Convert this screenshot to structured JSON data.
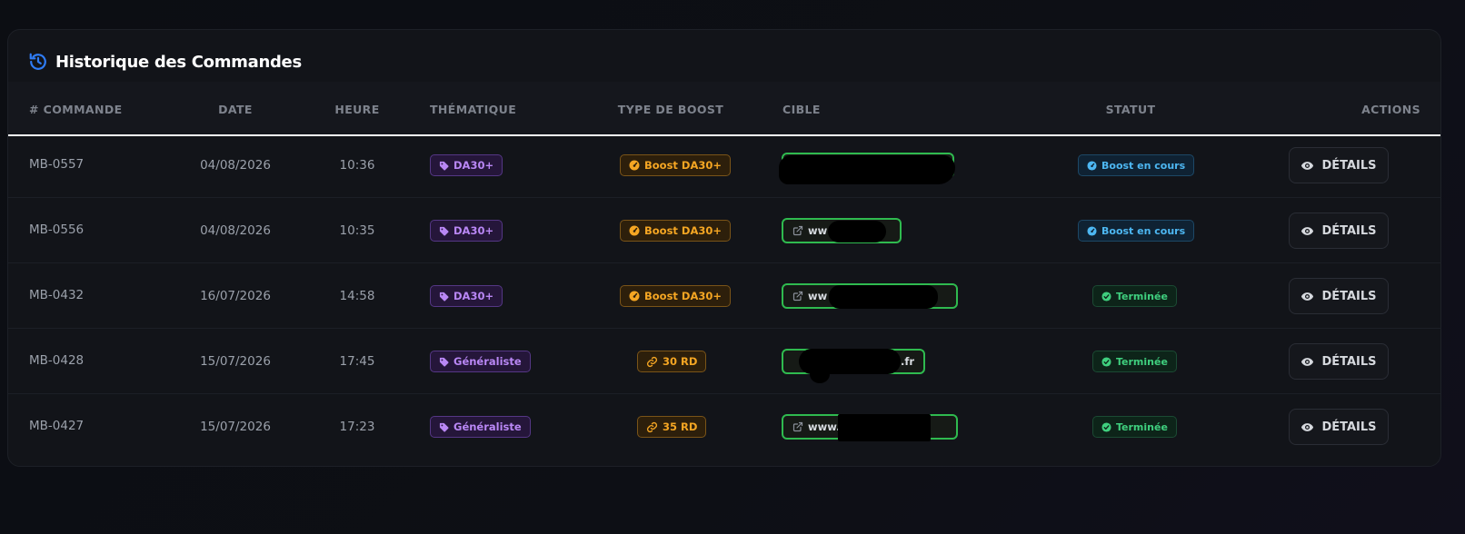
{
  "header": {
    "title": "Historique des Commandes",
    "icon": "history-icon"
  },
  "columns": {
    "commande": "# COMMANDE",
    "date": "DATE",
    "heure": "HEURE",
    "thematique": "THÉMATIQUE",
    "type_boost": "TYPE DE BOOST",
    "cible": "CIBLE",
    "statut": "STATUT",
    "actions": "ACTIONS"
  },
  "rows": [
    {
      "id": "MB-0557",
      "date": "04/08/2026",
      "time": "10:36",
      "theme": "DA30+",
      "boost": "Boost DA30+",
      "boost_icon": "gauge-icon",
      "target": "",
      "status": "Boost en cours",
      "action": "DÉTAILS"
    },
    {
      "id": "MB-0556",
      "date": "04/08/2026",
      "time": "10:35",
      "theme": "DA30+",
      "boost": "Boost DA30+",
      "boost_icon": "gauge-icon",
      "target": "ww          .fr",
      "status": "Boost en cours",
      "action": "DÉTAILS"
    },
    {
      "id": "MB-0432",
      "date": "16/07/2026",
      "time": "14:58",
      "theme": "DA30+",
      "boost": "Boost DA30+",
      "boost_icon": "gauge-icon",
      "target": "ww                    .fr",
      "status": "Terminée",
      "action": "DÉTAILS"
    },
    {
      "id": "MB-0428",
      "date": "15/07/2026",
      "time": "17:45",
      "theme": "Généraliste",
      "boost": "30 RD",
      "boost_icon": "link-icon",
      "target": ".fr",
      "status": "Terminée",
      "action": "DÉTAILS"
    },
    {
      "id": "MB-0427",
      "date": "15/07/2026",
      "time": "17:23",
      "theme": "Généraliste",
      "boost": "35 RD",
      "boost_icon": "link-icon",
      "target": "www.                    e.fr",
      "status": "Terminée",
      "action": "DÉTAILS"
    }
  ],
  "colors": {
    "accent": "#2f7cf6",
    "theme_badge": "#b987f5",
    "boost_badge": "#f5a623",
    "target_border": "#2fba4f",
    "status_progress": "#4db7f2",
    "status_done": "#3fcf7e"
  }
}
